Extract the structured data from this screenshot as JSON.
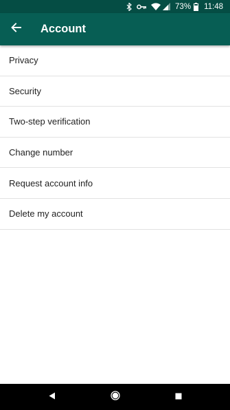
{
  "status_bar": {
    "battery_percent": "73%",
    "time": "11:48",
    "icons": [
      "bluetooth-icon",
      "key-icon",
      "wifi-icon",
      "signal-icon",
      "battery-icon"
    ]
  },
  "app_bar": {
    "title": "Account",
    "back_icon": "arrow-back-icon",
    "background_color": "#075e54"
  },
  "menu": {
    "items": [
      {
        "label": "Privacy"
      },
      {
        "label": "Security"
      },
      {
        "label": "Two-step verification"
      },
      {
        "label": "Change number"
      },
      {
        "label": "Request account info"
      },
      {
        "label": "Delete my account"
      }
    ]
  },
  "nav_bar": {
    "buttons": [
      "back-triangle-icon",
      "home-circle-icon",
      "recents-square-icon"
    ]
  }
}
